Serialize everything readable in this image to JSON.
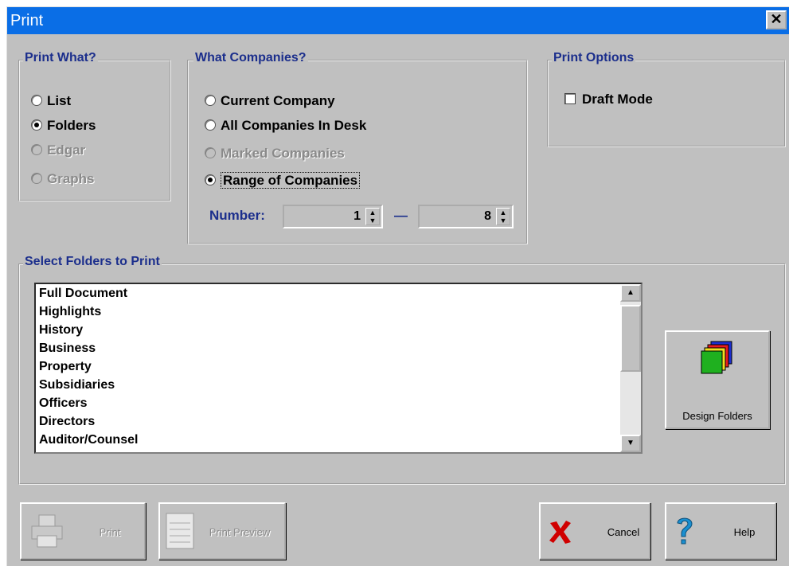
{
  "window": {
    "title": "Print",
    "close_glyph": "✕"
  },
  "print_what": {
    "legend": "Print What?",
    "options": [
      {
        "label": "List",
        "selected": false,
        "disabled": false
      },
      {
        "label": "Folders",
        "selected": true,
        "disabled": false
      },
      {
        "label": "Edgar",
        "selected": false,
        "disabled": true
      },
      {
        "label": "Graphs",
        "selected": false,
        "disabled": true
      }
    ]
  },
  "what_companies": {
    "legend": "What Companies?",
    "options": [
      {
        "label": "Current Company",
        "selected": false,
        "disabled": false
      },
      {
        "label": "All Companies In Desk",
        "selected": false,
        "disabled": false
      },
      {
        "label": "Marked Companies",
        "selected": false,
        "disabled": true
      },
      {
        "label": "Range of Companies",
        "selected": true,
        "disabled": false
      }
    ],
    "number_label": "Number:",
    "range_from": "1",
    "range_separator": "—",
    "range_to": "8"
  },
  "print_options": {
    "legend": "Print Options",
    "draft_mode_label": "Draft Mode",
    "draft_mode_checked": false
  },
  "folders": {
    "legend": "Select Folders to Print",
    "items": [
      "Full Document",
      "Highlights",
      "History",
      "Business",
      "Property",
      "Subsidiaries",
      "Officers",
      "Directors",
      "Auditor/Counsel"
    ],
    "design_button_label": "Design Folders"
  },
  "buttons": {
    "print": "Print",
    "print_preview": "Print Preview",
    "cancel": "Cancel",
    "help": "Help"
  },
  "icons": {
    "printer": "printer-icon",
    "preview": "print-preview-icon",
    "cancel": "cancel-x-icon",
    "help": "question-mark-icon",
    "folders": "folders-icon"
  },
  "colors": {
    "title_bar": "#0a6ee6",
    "legend_text": "#1b2e8c",
    "cancel_x": "#d00000",
    "help_q": "#1a8fd0"
  }
}
